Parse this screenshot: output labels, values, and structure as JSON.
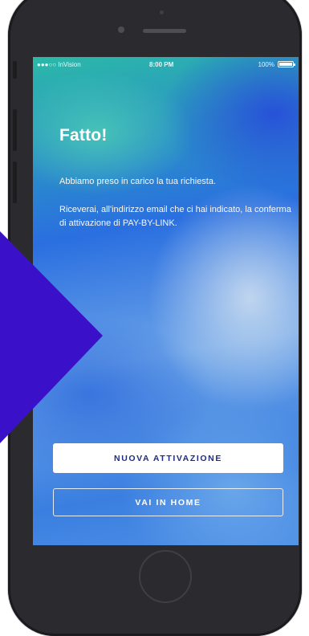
{
  "status_bar": {
    "carrier": "●●●○○ InVision",
    "time": "8:00 PM",
    "battery": "100%"
  },
  "screen": {
    "title": "Fatto!",
    "message_1": "Abbiamo preso in carico la tua richiesta.",
    "message_2": "Riceverai, all'indirizzo email che ci hai indicato, la conferma di attivazione di PAY-BY-LINK."
  },
  "buttons": {
    "primary_label": "NUOVA ATTIVAZIONE",
    "secondary_label": "VAI IN HOME"
  },
  "colors": {
    "brand_diamond": "#3a10c8",
    "primary_button_text": "#1f2c84"
  },
  "icons": [
    "wifi-icon",
    "battery-icon",
    "brand-diamond-shape"
  ]
}
